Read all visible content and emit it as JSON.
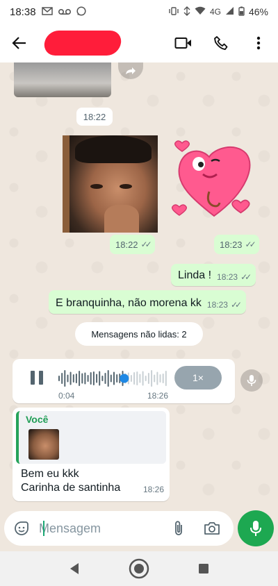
{
  "status_bar": {
    "time": "18:38",
    "network": "4G",
    "battery": "46%",
    "left_icons": [
      "gmail-icon",
      "voicemail-icon",
      "whatsapp-icon"
    ],
    "right_icons": [
      "vibrate-icon",
      "data-saver-icon",
      "wifi-icon",
      "signal-icon",
      "battery-icon"
    ]
  },
  "header": {
    "contact_name_redacted": true,
    "actions": [
      "video-call-icon",
      "phone-icon",
      "more-icon"
    ]
  },
  "messages": {
    "date_chip": "18:22",
    "photo_time": "18:22",
    "sticker_time": "18:23",
    "msg1": {
      "text": "Linda !",
      "time": "18:23"
    },
    "msg2": {
      "text": "E branquinha, não morena kk",
      "time": "18:23"
    },
    "unread_chip": "Mensagens não lidas: 2",
    "audio": {
      "elapsed": "0:04",
      "time": "18:26",
      "speed": "1×",
      "progress": 0.6
    },
    "reply": {
      "quoted_author": "Você",
      "line1": "Bem eu kkk",
      "line2": "Carinha de santinha",
      "time": "18:26"
    }
  },
  "input": {
    "placeholder": "Mensagem"
  },
  "colors": {
    "outgoing_bubble": "#d9fdd3",
    "incoming_bubble": "#ffffff",
    "chat_background": "#efe7de",
    "accent_green": "#1da851",
    "audio_progress": "#1e88e5",
    "redaction": "#ff1d3a"
  }
}
